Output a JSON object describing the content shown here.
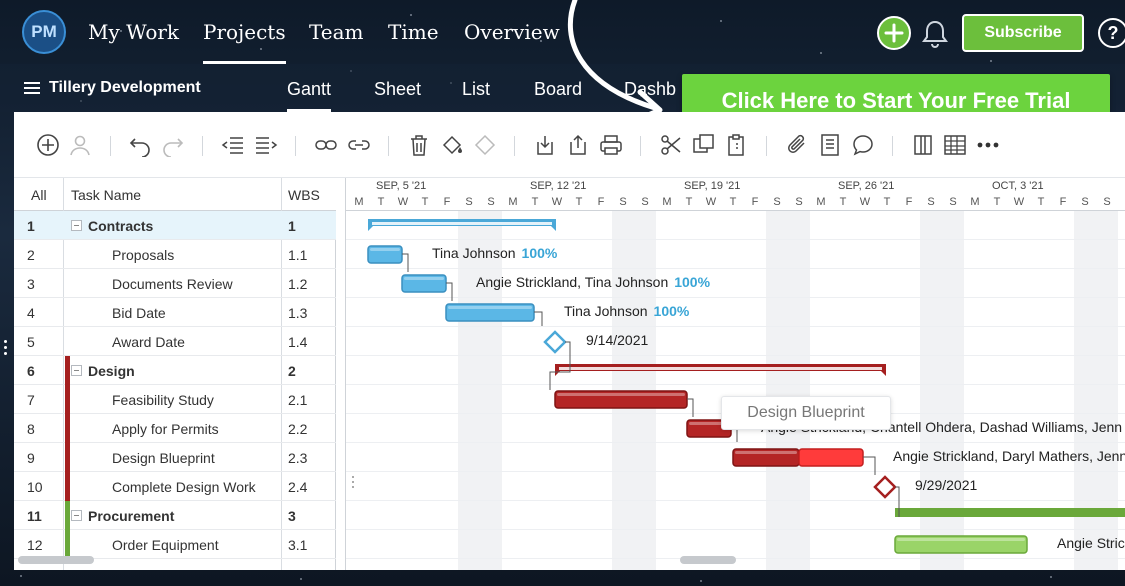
{
  "logo_text": "PM",
  "nav": {
    "items": [
      "My Work",
      "Projects",
      "Team",
      "Time",
      "Overview"
    ],
    "active": "Projects"
  },
  "subscribe_label": "Subscribe",
  "help_label": "?",
  "project_title": "Tillery Development",
  "view_tabs": [
    "Gantt",
    "Sheet",
    "List",
    "Board",
    "Dashb"
  ],
  "cta_label": "Click Here to Start Your Free Trial",
  "toolbar_icons": [
    "add-icon",
    "assign-user-icon",
    "undo-icon",
    "redo-icon",
    "outdent-icon",
    "indent-icon",
    "link-icon",
    "unlink-icon",
    "delete-icon",
    "fill-color-icon",
    "milestone-icon",
    "import-icon",
    "export-icon",
    "print-icon",
    "cut-icon",
    "copy-icon",
    "paste-icon",
    "attach-icon",
    "notes-icon",
    "comment-icon",
    "columns-icon",
    "table-icon",
    "more-icon"
  ],
  "grid": {
    "headers": {
      "all": "All",
      "task": "Task Name",
      "wbs": "WBS"
    },
    "rows": [
      {
        "num": "1",
        "name": "Contracts",
        "wbs": "1",
        "group": true
      },
      {
        "num": "2",
        "name": "Proposals",
        "wbs": "1.1"
      },
      {
        "num": "3",
        "name": "Documents Review",
        "wbs": "1.2"
      },
      {
        "num": "4",
        "name": "Bid Date",
        "wbs": "1.3"
      },
      {
        "num": "5",
        "name": "Award Date",
        "wbs": "1.4"
      },
      {
        "num": "6",
        "name": "Design",
        "wbs": "2",
        "group": true
      },
      {
        "num": "7",
        "name": "Feasibility Study",
        "wbs": "2.1"
      },
      {
        "num": "8",
        "name": "Apply for Permits",
        "wbs": "2.2"
      },
      {
        "num": "9",
        "name": "Design Blueprint",
        "wbs": "2.3"
      },
      {
        "num": "10",
        "name": "Complete Design Work",
        "wbs": "2.4"
      },
      {
        "num": "11",
        "name": "Procurement",
        "wbs": "3",
        "group": true
      },
      {
        "num": "12",
        "name": "Order Equipment",
        "wbs": "3.1"
      }
    ]
  },
  "timeline": {
    "weeks": [
      "SEP, 5 '21",
      "SEP, 12 '21",
      "SEP, 19 '21",
      "SEP, 26 '21",
      "OCT, 3 '21"
    ],
    "days": [
      "M",
      "T",
      "W",
      "T",
      "F",
      "S",
      "S",
      "M",
      "T",
      "W",
      "T",
      "F",
      "S",
      "S",
      "M",
      "T",
      "W",
      "T",
      "F",
      "S",
      "S",
      "M",
      "T",
      "W",
      "T",
      "F",
      "S",
      "S",
      "M",
      "T",
      "W",
      "T",
      "F",
      "S",
      "S"
    ]
  },
  "bar_labels": {
    "r2": {
      "who": "Tina Johnson",
      "pct": "100%"
    },
    "r3": {
      "who": "Angie Strickland, Tina Johnson",
      "pct": "100%"
    },
    "r4": {
      "who": "Tina Johnson",
      "pct": "100%"
    },
    "r5": "9/14/2021",
    "r8": "Angie Strickland, Chantell Ohdera, Dashad Williams, Jenn",
    "r9": "Angie Strickland, Daryl Mathers, Jenn",
    "r10": "9/29/2021",
    "r12": "Angie Stric"
  },
  "tooltip": "Design Blueprint",
  "colors": {
    "contracts": "#4aa8d8",
    "design": "#a51f1f",
    "procurement": "#6aa83a",
    "cta": "#6cd33e",
    "accent_green": "#6cbf3c"
  }
}
